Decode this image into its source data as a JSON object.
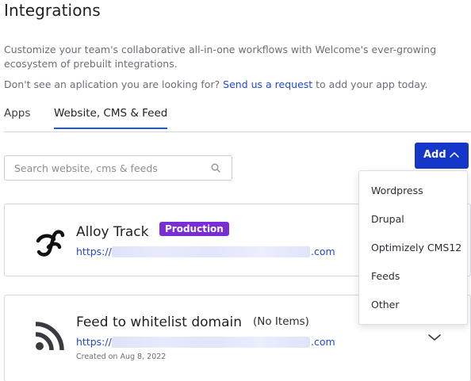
{
  "header": {
    "title": "Integrations"
  },
  "intro": {
    "description": "Customize your team's collaborative all-in-one workflows with Welcome's ever-growing ecosystem of prebuilt integrations.",
    "prompt_prefix": "Don't see an aplication you are looking for?",
    "request_link": "Send us a request",
    "prompt_suffix": " to add your app today."
  },
  "tabs": [
    {
      "label": "Apps",
      "active": false
    },
    {
      "label": "Website, CMS & Feed",
      "active": true
    }
  ],
  "search": {
    "placeholder": "Search website, cms & feeds"
  },
  "add_button": {
    "label": "Add"
  },
  "add_menu": {
    "items": [
      {
        "label": "Wordpress"
      },
      {
        "label": "Drupal"
      },
      {
        "label": "Optimizely CMS12"
      },
      {
        "label": "Feeds"
      },
      {
        "label": "Other"
      }
    ]
  },
  "integrations": [
    {
      "name": "Alloy Track",
      "badge": "Production",
      "url_prefix": "https://",
      "url_suffix": ".com",
      "icon": "alloy-logo-icon"
    },
    {
      "name": "Feed to whitelist domain",
      "status": "(No Items)",
      "url_prefix": "https://",
      "url_suffix": ".com",
      "created": "Created on Aug 8, 2022",
      "icon": "rss-icon"
    }
  ],
  "colors": {
    "primary": "#1537c9",
    "link": "#2148d6",
    "badge": "#7a2dd6",
    "tab_underline": "#1a56e8"
  }
}
